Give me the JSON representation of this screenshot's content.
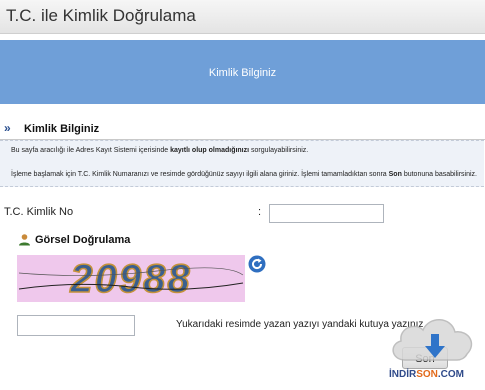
{
  "window": {
    "title": "T.C. ile Kimlik Doğrulama"
  },
  "banner": {
    "text": "Kimlik Bilginiz"
  },
  "section": {
    "chevron": "»",
    "title": "Kimlik Bilginiz"
  },
  "info": {
    "line1_before": "Bu sayfa aracılığı ile Adres Kayıt Sistemi içerisinde ",
    "line1_bold": "kayıtlı olup olmadığınızı",
    "line1_after": " sorgulayabilirsiniz.",
    "line2_before": "İşleme başlamak için T.C. Kimlik Numaranızı ve resimde gördüğünüz sayıyı ilgili alana giriniz. İşlemi tamamladıktan sonra ",
    "line2_bold": "Son",
    "line2_after": " butonuna basabilirsiniz."
  },
  "form": {
    "tc_label": "T.C. Kimlik No",
    "tc_colon": ":",
    "tc_value": "",
    "captcha_title": "Görsel Doğrulama",
    "captcha_code": "20988",
    "code_value": "",
    "hint": "Yukarıdaki resimde yazan yazıyı yandaki kutuya yazınız",
    "submit_label": "Son"
  },
  "watermark": {
    "part1": "İNDİR",
    "part2": "SON",
    "part3": ".COM"
  },
  "icons": {
    "section_chevron": "double-chevron-right-icon",
    "captcha_person": "person-icon",
    "refresh": "refresh-icon",
    "watermark_cloud": "cloud-download-icon"
  },
  "colors": {
    "banner": "#6f9fd8",
    "info_bg": "#eef2f8",
    "captcha_bg": "#efc8ec",
    "captcha_text": "#3a5f8f"
  }
}
